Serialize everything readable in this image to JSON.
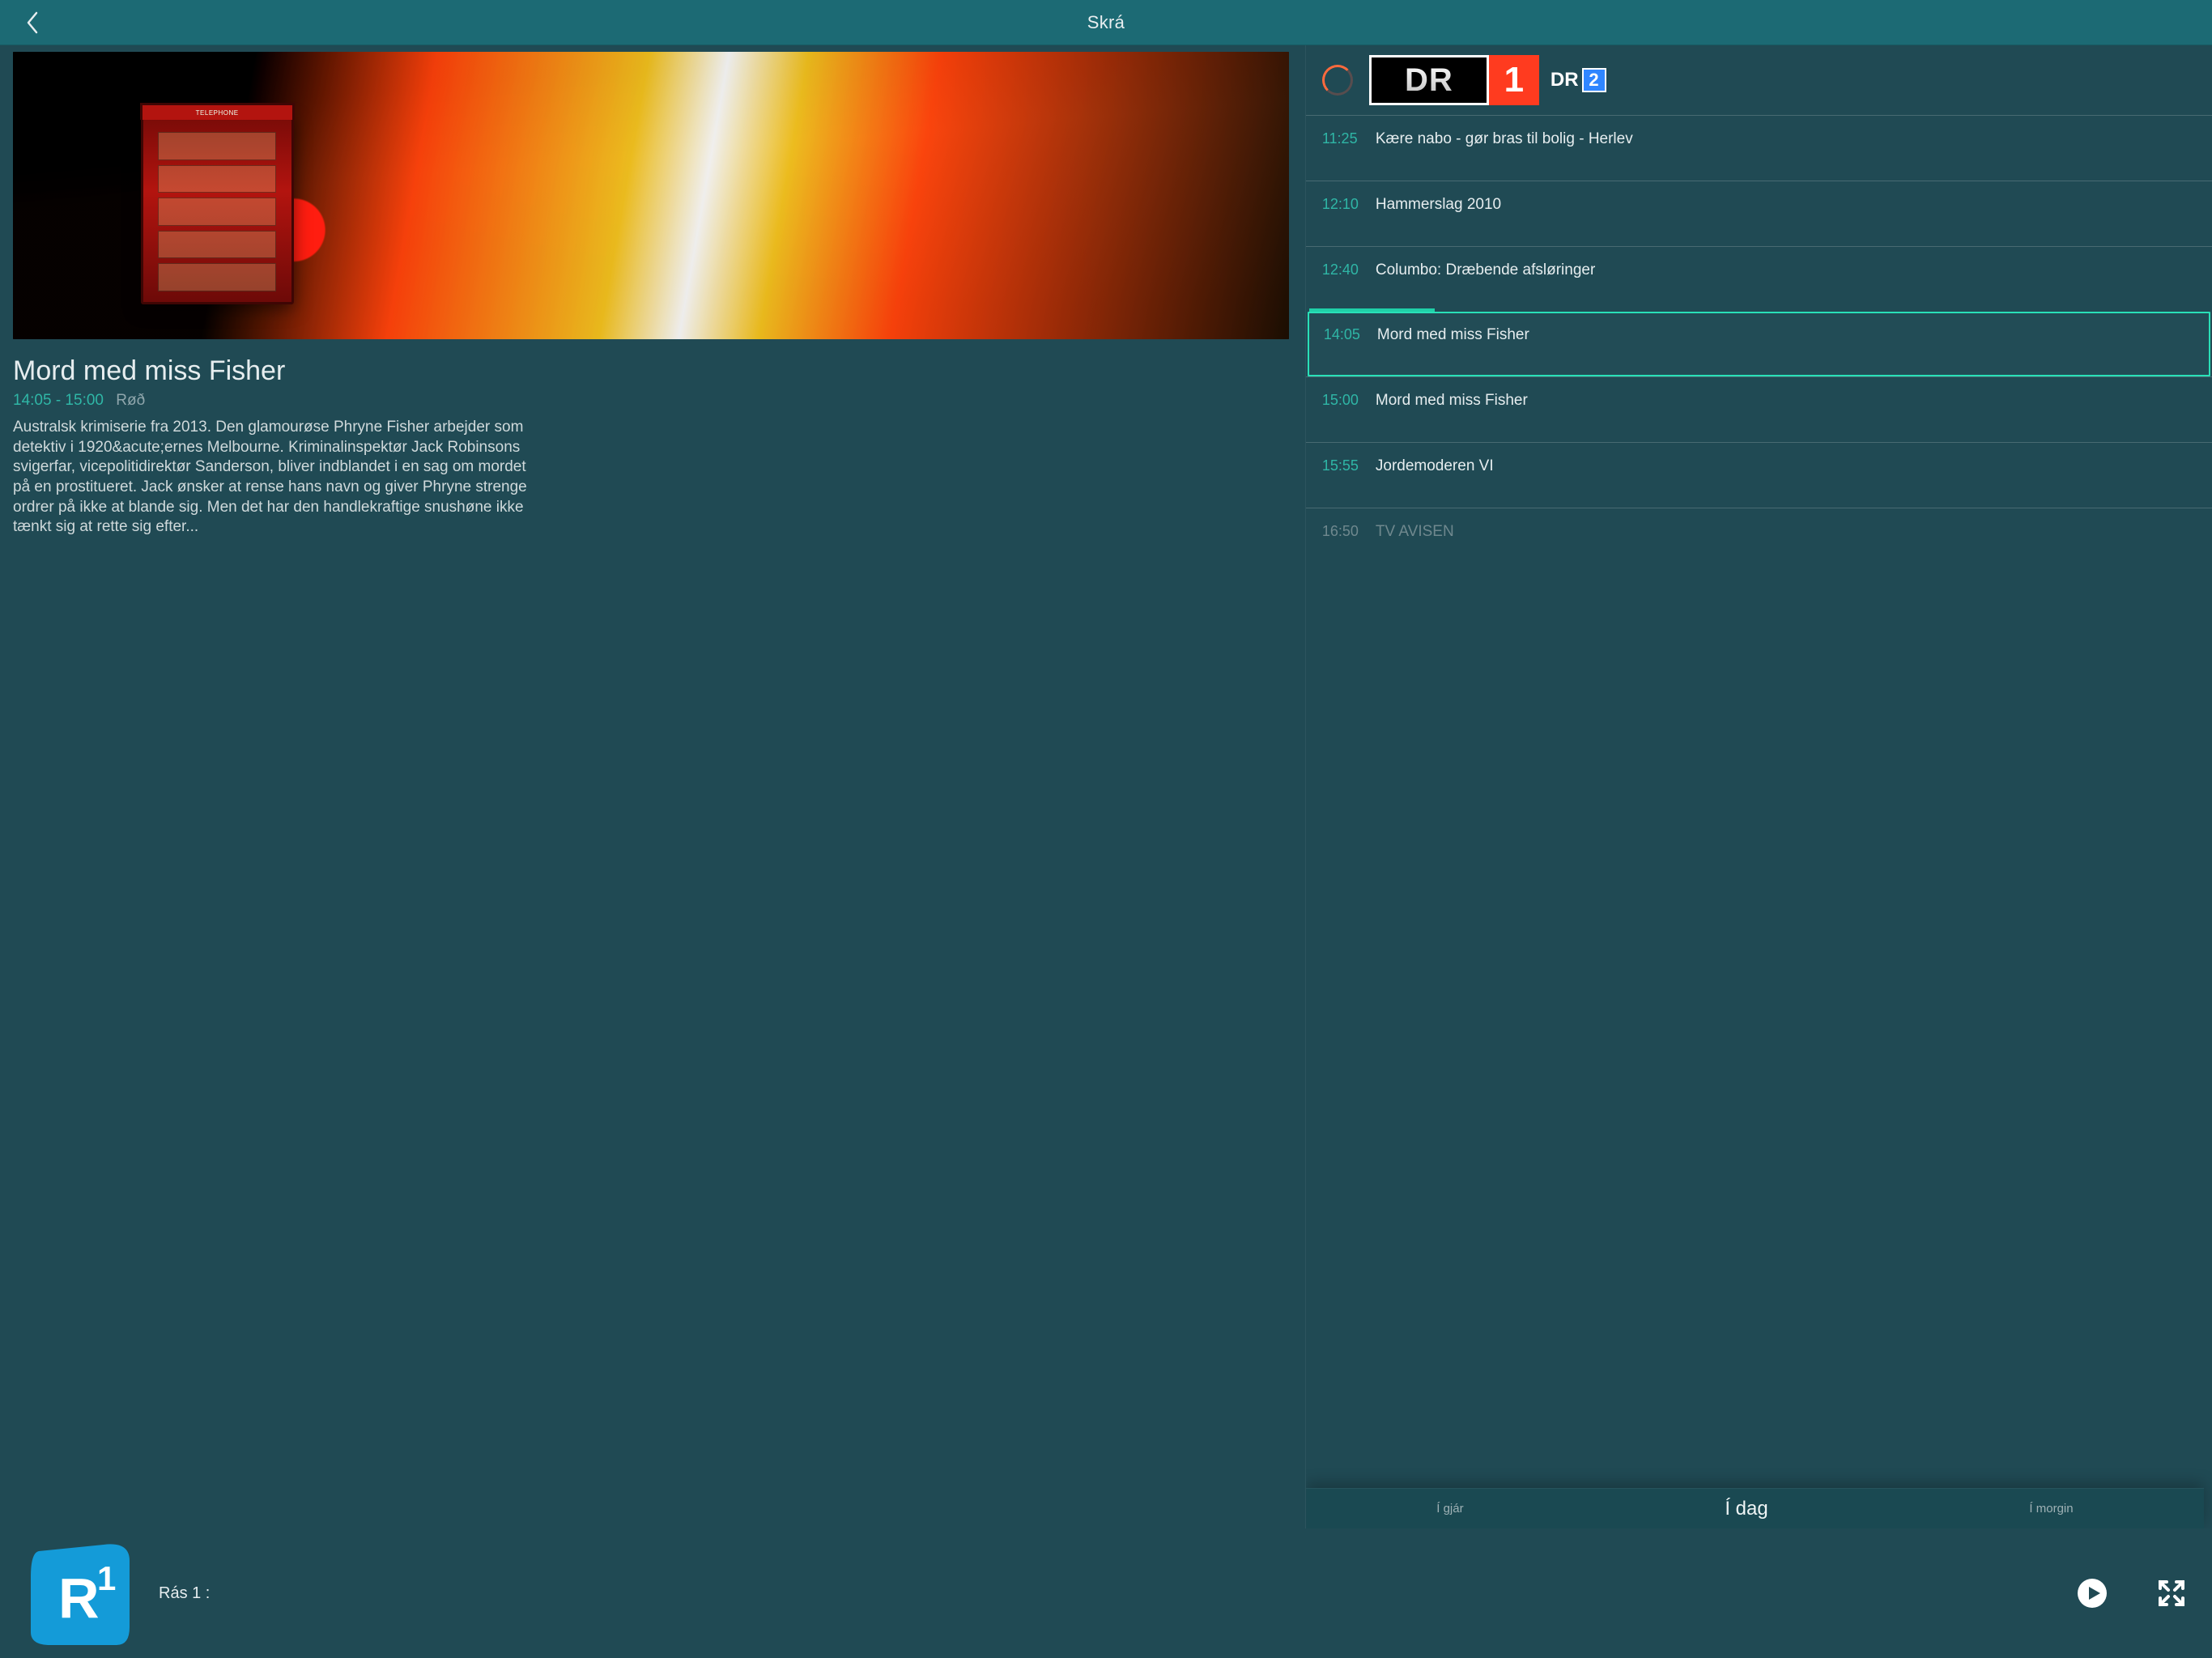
{
  "header": {
    "title": "Skrá"
  },
  "detail": {
    "title": "Mord med miss Fisher",
    "time_range": "14:05 - 15:00",
    "category": "Røð",
    "description": "Australsk krimiserie fra 2013. Den glamourøse Phryne Fisher arbejder som detektiv i 1920&acute;ernes Melbourne. Kriminalinspektør Jack Robinsons svigerfar, vicepolitidirektør Sanderson, bliver indblandet i en sag om mordet på en prostitueret. Jack ønsker at rense hans navn og giver Phryne strenge ordrer på ikke at blande sig. Men det har den handlekraftige snushøne ikke tænkt sig at rette sig efter..."
  },
  "channels": {
    "dr1_text": "DR",
    "dr1_num": "1",
    "dr2_text": "DR",
    "dr2_num": "2"
  },
  "schedule": [
    {
      "time": "11:25",
      "title": "Kære nabo - gør bras til bolig - Herlev",
      "state": ""
    },
    {
      "time": "12:10",
      "title": "Hammerslag 2010",
      "state": ""
    },
    {
      "time": "12:40",
      "title": "Columbo: Dræbende afsløringer",
      "state": ""
    },
    {
      "time": "14:05",
      "title": "Mord med miss Fisher",
      "state": "current"
    },
    {
      "time": "15:00",
      "title": "Mord med miss Fisher",
      "state": ""
    },
    {
      "time": "15:55",
      "title": "Jordemoderen VI",
      "state": ""
    },
    {
      "time": "16:50",
      "title": "TV AVISEN",
      "state": "cut"
    }
  ],
  "day_tabs": {
    "yesterday": "Í gjár",
    "today": "Í dag",
    "tomorrow": "Í morgin"
  },
  "footer": {
    "now_playing": "Rás 1 :",
    "logo_letter": "R",
    "logo_num": "1"
  }
}
